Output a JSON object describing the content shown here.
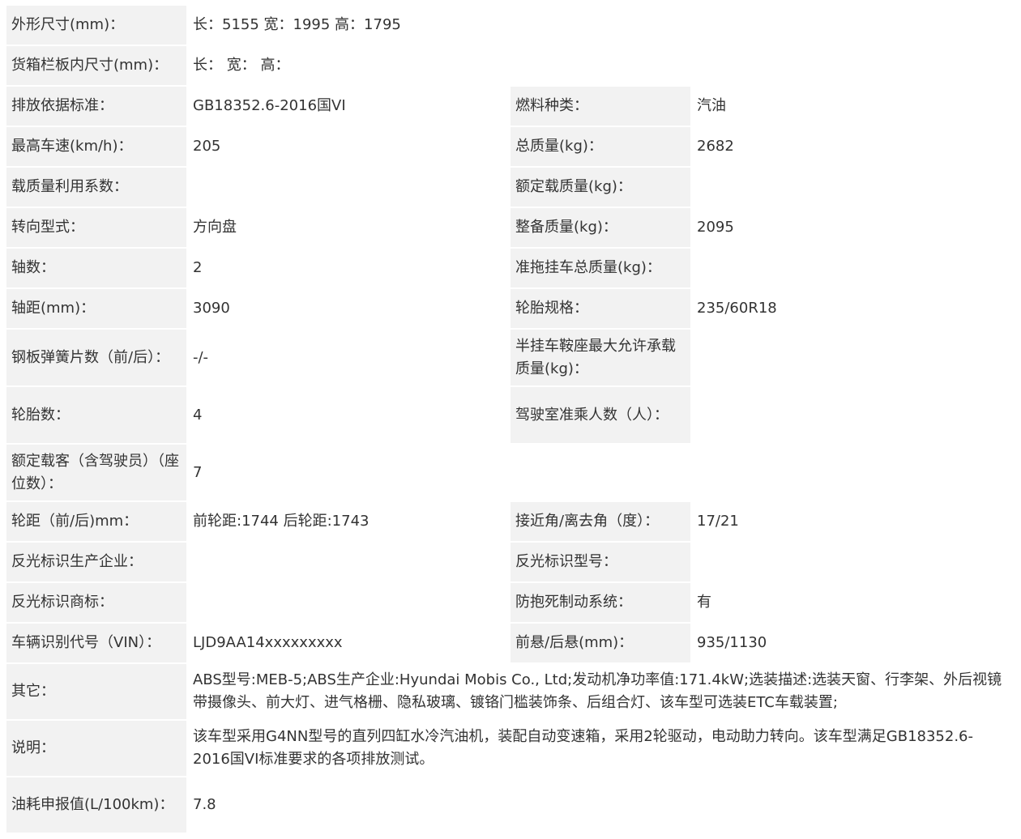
{
  "rows": [
    {
      "label": "外形尺寸(mm)：",
      "value": "长：5155 宽：1995 高：1795"
    },
    {
      "label": "货箱栏板内尺寸(mm)：",
      "value": "长： 宽： 高："
    },
    {
      "label": "排放依据标准：",
      "value": "GB18352.6-2016国VI",
      "label2": "燃料种类：",
      "value2": "汽油"
    },
    {
      "label": "最高车速(km/h)：",
      "value": "205",
      "label2": "总质量(kg)：",
      "value2": "2682"
    },
    {
      "label": "载质量利用系数：",
      "value": "",
      "label2": "额定载质量(kg)：",
      "value2": ""
    },
    {
      "label": "转向型式：",
      "value": "方向盘",
      "label2": "整备质量(kg)：",
      "value2": "2095"
    },
    {
      "label": "轴数：",
      "value": "2",
      "label2": "准拖挂车总质量(kg)：",
      "value2": ""
    },
    {
      "label": "轴距(mm)：",
      "value": "3090",
      "label2": "轮胎规格：",
      "value2": "235/60R18"
    },
    {
      "label": "钢板弹簧片数（前/后）：",
      "value": "-/-",
      "label2": "半挂车鞍座最大允许承载质量(kg)：",
      "value2": ""
    },
    {
      "label": "轮胎数：",
      "value": "4",
      "label2": "驾驶室准乘人数（人）：",
      "value2": ""
    },
    {
      "label": "额定载客（含驾驶员）（座位数）：",
      "value": "7"
    },
    {
      "label": "轮距（前/后)mm：",
      "value": "前轮距:1744 后轮距:1743",
      "label2": "接近角/离去角（度）：",
      "value2": "17/21"
    },
    {
      "label": "反光标识生产企业：",
      "value": "",
      "label2": "反光标识型号：",
      "value2": ""
    },
    {
      "label": "反光标识商标：",
      "value": "",
      "label2": "防抱死制动系统：",
      "value2": "有"
    },
    {
      "label": "车辆识别代号（VIN）：",
      "value": "LJD9AA14xxxxxxxxx",
      "label2": "前悬/后悬(mm)：",
      "value2": "935/1130"
    },
    {
      "label": "其它：",
      "value": "ABS型号:MEB-5;ABS生产企业:Hyundai Mobis Co., Ltd;发动机净功率值:171.4kW;选装描述:选装天窗、行李架、外后视镜带摄像头、前大灯、进气格栅、隐私玻璃、镀铬门槛装饰条、后组合灯、该车型可选装ETC车载装置;"
    },
    {
      "label": "说明：",
      "value": "该车型采用G4NN型号的直列四缸水冷汽油机，装配自动变速箱，采用2轮驱动，电动助力转向。该车型满足GB18352.6-2016国VI标准要求的各项排放测试。"
    },
    {
      "label": "油耗申报值(L/100km)：",
      "value": "7.8"
    }
  ]
}
